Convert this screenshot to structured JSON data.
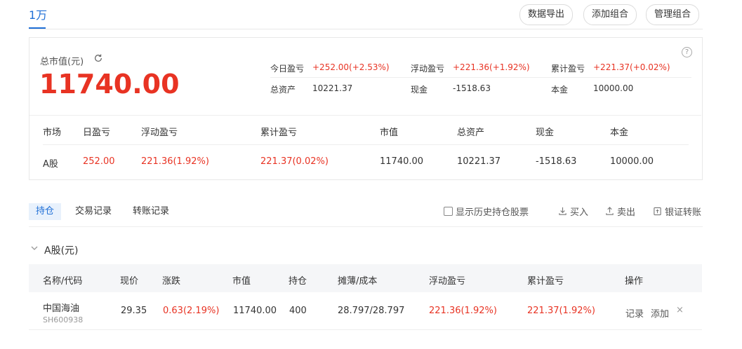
{
  "tabs": {
    "active": "1万"
  },
  "toolbar": {
    "export_label": "数据导出",
    "add_group_label": "添加组合",
    "manage_group_label": "管理组合"
  },
  "summary": {
    "total_label": "总市值(元)",
    "total_value": "11740.00",
    "today_pnl_label": "今日盈亏",
    "today_pnl_value": "+252.00(+2.53%)",
    "float_pnl_label": "浮动盈亏",
    "float_pnl_value": "+221.36(+1.92%)",
    "cum_pnl_label": "累计盈亏",
    "cum_pnl_value": "+221.37(+0.02%)",
    "assets_label": "总资产",
    "assets_value": "10221.37",
    "cash_label": "现金",
    "cash_value": "-1518.63",
    "principal_label": "本金",
    "principal_value": "10000.00"
  },
  "market_table": {
    "headers": [
      "市场",
      "日盈亏",
      "浮动盈亏",
      "累计盈亏",
      "市值",
      "总资产",
      "现金",
      "本金"
    ],
    "row": [
      "A股",
      "252.00",
      "221.36(1.92%)",
      "221.37(0.02%)",
      "11740.00",
      "10221.37",
      "-1518.63",
      "10000.00"
    ]
  },
  "subtabs": [
    "持仓",
    "交易记录",
    "转账记录"
  ],
  "actions": {
    "show_history_label": "显示历史持仓股票",
    "buy_label": "买入",
    "sell_label": "卖出",
    "bank_transfer_label": "银证转账"
  },
  "holdings": {
    "section_title": "A股(元)",
    "headers": [
      "名称/代码",
      "现价",
      "涨跌",
      "市值",
      "持仓",
      "摊薄/成本",
      "浮动盈亏",
      "累计盈亏",
      "操作"
    ],
    "rows": [
      {
        "name": "中国海油",
        "code": "SH600938",
        "price": "29.35",
        "change": "0.63(2.19%)",
        "market_value": "11740.00",
        "position": "400",
        "cost": "28.797/28.797",
        "float_pnl": "221.36(1.92%)",
        "cum_pnl": "221.37(1.92%)",
        "op_record": "记录",
        "op_add": "添加",
        "op_remove": "×"
      }
    ]
  },
  "colors": {
    "accent": "#1f6fd6",
    "up": "#e83323"
  }
}
